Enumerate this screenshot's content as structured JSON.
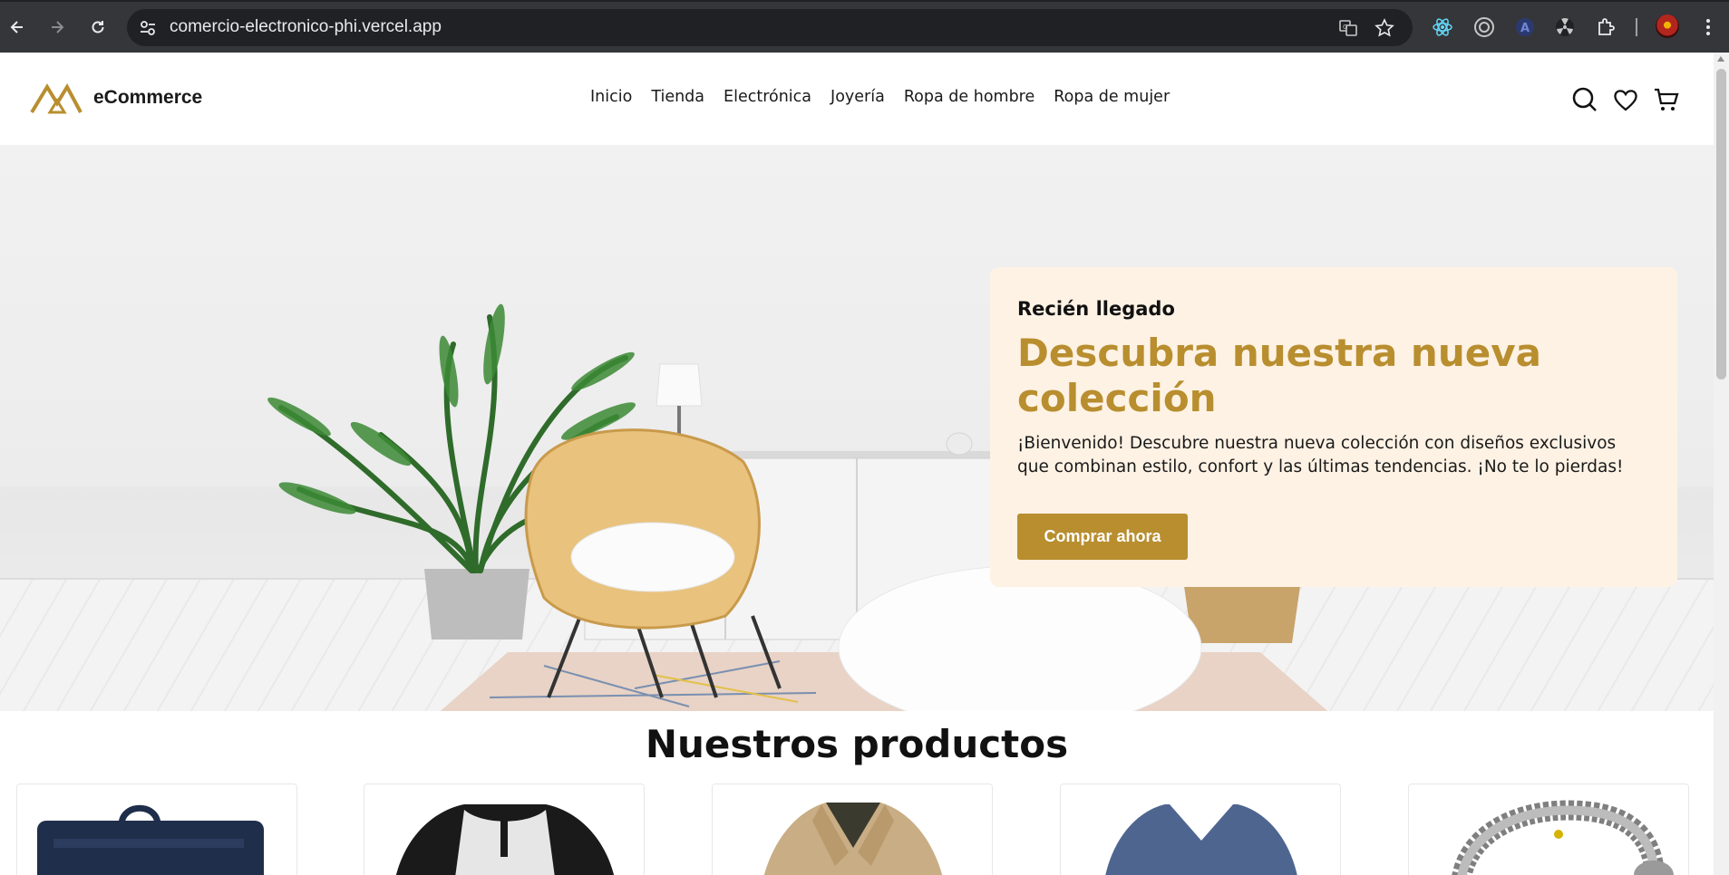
{
  "browser": {
    "url": "comercio-electronico-phi.vercel.app",
    "icons": [
      "back-icon",
      "forward-icon",
      "reload-icon",
      "site-info-icon",
      "translate-icon",
      "bookmark-star-icon",
      "react-devtools-icon",
      "extension-target-icon",
      "extension-a-icon",
      "extension-radiation-icon",
      "extensions-puzzle-icon",
      "profile-avatar",
      "menu-kebab-icon"
    ]
  },
  "header": {
    "brand": "eCommerce",
    "nav": [
      "Inicio",
      "Tienda",
      "Electrónica",
      "Joyería",
      "Ropa de hombre",
      "Ropa de mujer"
    ],
    "icons": [
      "search-icon",
      "heart-icon",
      "cart-icon"
    ]
  },
  "hero": {
    "eyebrow": "Recién llegado",
    "headline": "Descubra nuestra nueva colección",
    "description": "¡Bienvenido! Descubre nuestra nueva colección con diseños exclusivos que combinan estilo, confort y las últimas tendencias. ¡No te lo pierdas!",
    "cta": "Comprar ahora"
  },
  "products": {
    "title": "Nuestros productos",
    "items": [
      "backpack",
      "raglan-shirt",
      "jacket",
      "v-neck-tshirt",
      "dragon-bracelet"
    ]
  },
  "colors": {
    "accent": "#b88e2f",
    "promo_bg": "#fef2e4",
    "chrome_bg": "#35363a",
    "omnibox_bg": "#202124"
  }
}
